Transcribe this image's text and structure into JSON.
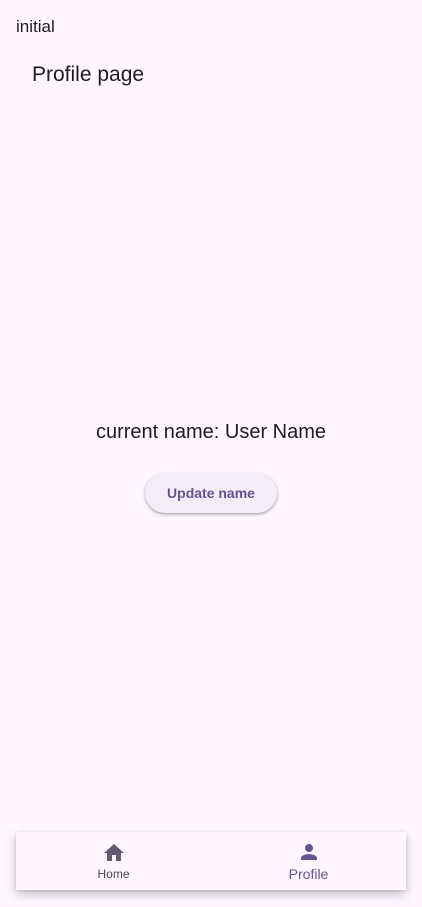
{
  "app": {
    "status_label": "initial"
  },
  "page": {
    "title": "Profile page",
    "current_name_text": "current name: User Name",
    "update_button_label": "Update name"
  },
  "bottom_nav": {
    "items": [
      {
        "label": "Home",
        "icon": "home-icon",
        "active": false
      },
      {
        "label": "Profile",
        "icon": "person-icon",
        "active": true
      }
    ]
  },
  "colors": {
    "background": "#fef7ff",
    "accent": "#65558f",
    "inactive": "#49454f",
    "button_bg": "#f3edf7"
  }
}
